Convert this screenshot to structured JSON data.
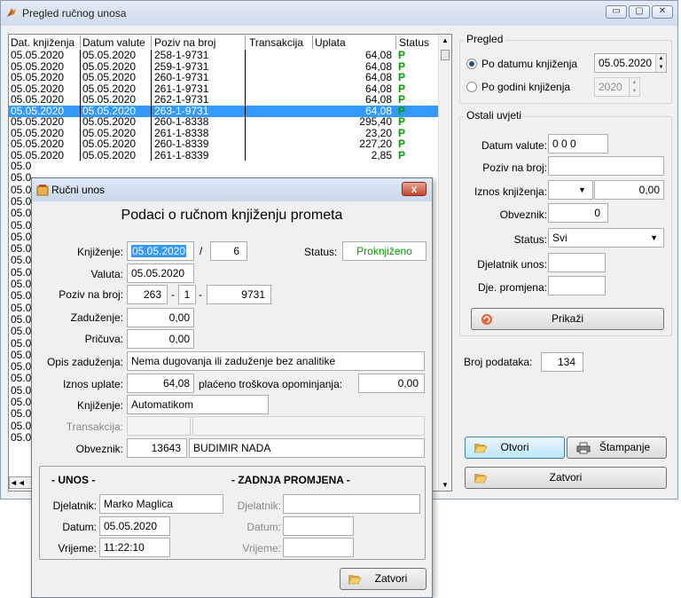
{
  "main": {
    "title": "Pregled ručnog unosa",
    "grid": {
      "columns": [
        "Dat. knjiženja",
        "Datum valute",
        "Poziv na broj",
        "Transakcija",
        "Uplata",
        "Status"
      ],
      "rows": [
        {
          "dat": "05.05.2020",
          "val": "05.05.2020",
          "poziv": "258-1-9731",
          "uplata": "64,08",
          "status": "P"
        },
        {
          "dat": "05.05.2020",
          "val": "05.05.2020",
          "poziv": "259-1-9731",
          "uplata": "64,08",
          "status": "P"
        },
        {
          "dat": "05.05.2020",
          "val": "05.05.2020",
          "poziv": "260-1-9731",
          "uplata": "64,08",
          "status": "P"
        },
        {
          "dat": "05.05.2020",
          "val": "05.05.2020",
          "poziv": "261-1-9731",
          "uplata": "64,08",
          "status": "P"
        },
        {
          "dat": "05.05.2020",
          "val": "05.05.2020",
          "poziv": "262-1-9731",
          "uplata": "64,08",
          "status": "P"
        },
        {
          "dat": "05.05.2020",
          "val": "05.05.2020",
          "poziv": "263-1-9731",
          "uplata": "64,08",
          "status": "P"
        },
        {
          "dat": "05.05.2020",
          "val": "05.05.2020",
          "poziv": "260-1-8338",
          "uplata": "295,40",
          "status": "P"
        },
        {
          "dat": "05.05.2020",
          "val": "05.05.2020",
          "poziv": "261-1-8338",
          "uplata": "23,20",
          "status": "P"
        },
        {
          "dat": "05.05.2020",
          "val": "05.05.2020",
          "poziv": "260-1-8339",
          "uplata": "227,20",
          "status": "P"
        },
        {
          "dat": "05.05.2020",
          "val": "05.05.2020",
          "poziv": "261-1-8339",
          "uplata": "2,85",
          "status": "P"
        }
      ],
      "selected_index": 5,
      "row_stub": "05.0",
      "stub_rows": 24
    },
    "pregled": {
      "group_label": "Pregled",
      "radio1": "Po datumu knjiženja",
      "date1": "05.05.2020",
      "radio2": "Po godini knjiženja",
      "year": "2020"
    },
    "ostali": {
      "group_label": "Ostali uvjeti",
      "datum_valute_label": "Datum valute:",
      "datum_valute_value": "0 0 0",
      "poziv_label": "Poziv na broj:",
      "iznos_label": "Iznos knjiženja:",
      "iznos_value": "0,00",
      "obveznik_label": "Obveznik:",
      "obveznik_value": "0",
      "status_label": "Status:",
      "status_value": "Svi",
      "djelatnik_unos_label": "Djelatnik unos:",
      "dje_promjena_label": "Dje. promjena:",
      "prikazi_label": "Prikaži"
    },
    "broj_label": "Broj podataka:",
    "broj_value": "134",
    "otvori_label": "Otvori",
    "stampanje_label": "Štampanje",
    "zatvori_label": "Zatvori"
  },
  "dialog": {
    "title": "Ručni unos",
    "heading": "Podaci o ručnom knjiženju prometa",
    "knjizenje_label": "Knjiženje:",
    "knjizenje_date": "05.05.2020",
    "slash": "/",
    "knjizenje_num": "6",
    "status_label": "Status:",
    "status_value": "Proknjiženo",
    "valuta_label": "Valuta:",
    "valuta_value": "05.05.2020",
    "poziv_label": "Poziv na broj:",
    "poziv_a": "263",
    "dash1": "-",
    "poziv_b": "1",
    "dash2": "-",
    "poziv_c": "9731",
    "zaduzenje_label": "Zaduženje:",
    "zaduzenje_value": "0,00",
    "pricuva_label": "Pričuva:",
    "pricuva_value": "0,00",
    "opis_label": "Opis zaduženja:",
    "opis_value": "Nema dugovanja ili zaduženje bez analitike",
    "iznos_uplate_label": "Iznos uplate:",
    "iznos_uplate_value": "64,08",
    "placeno_label": "plaćeno troškova opominjanja:",
    "placeno_value": "0,00",
    "knjizenje2_label": "Knjiženje:",
    "knjizenje2_value": "Automatikom",
    "transakcija_label": "Transakcija:",
    "obveznik_label": "Obveznik:",
    "obveznik_id": "13643",
    "obveznik_name": "BUDIMIR NADA",
    "unos_header": "- UNOS -",
    "zadnja_header": "- ZADNJA PROMJENA -",
    "djelatnik_label": "Djelatnik:",
    "djelatnik_value": "Marko Maglica",
    "datum_label": "Datum:",
    "datum_value": "05.05.2020",
    "vrijeme_label": "Vrijeme:",
    "vrijeme_value": "11:22:10",
    "z_djelatnik_label": "Djelatnik:",
    "z_datum_label": "Datum:",
    "z_vrijeme_label": "Vrijeme:",
    "zatvori_label": "Zatvori",
    "close_glyph": "x"
  }
}
